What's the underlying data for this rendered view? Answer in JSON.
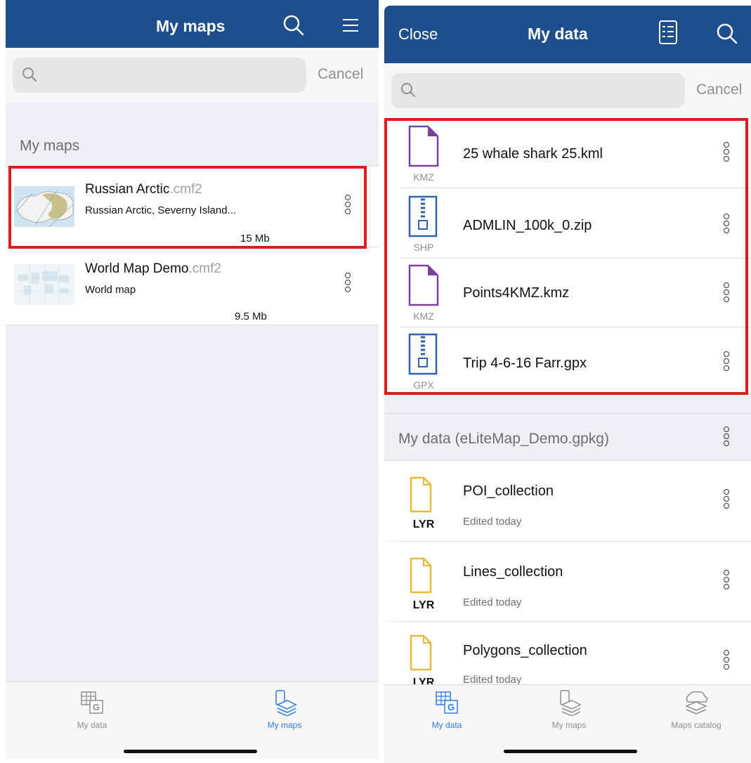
{
  "left": {
    "nav_title": "My maps",
    "search": {
      "placeholder": "",
      "cancel": "Cancel"
    },
    "section": "My maps",
    "maps": [
      {
        "name": "Russian Arctic",
        "ext": ".cmf2",
        "desc": "Russian Arctic, Severny Island...",
        "size": "15 Mb",
        "highlighted": true
      },
      {
        "name": "World Map Demo",
        "ext": ".cmf2",
        "desc": "World map",
        "size": "9.5 Mb",
        "highlighted": false
      }
    ],
    "tabs": [
      {
        "label": "My data",
        "icon": "table-g-icon",
        "active": false
      },
      {
        "label": "My maps",
        "icon": "layers-icon",
        "active": true
      }
    ]
  },
  "right": {
    "nav_close": "Close",
    "nav_title": "My data",
    "search": {
      "placeholder": "",
      "cancel": "Cancel"
    },
    "files": [
      {
        "name": "25 whale shark 25.kml",
        "type": "KMZ",
        "icon": "document-icon",
        "color": "#7b3fa0"
      },
      {
        "name": "ADMLIN_100k_0.zip",
        "type": "SHP",
        "icon": "zip-icon",
        "color": "#2d62b0"
      },
      {
        "name": "Points4KMZ.kmz",
        "type": "KMZ",
        "icon": "document-icon",
        "color": "#7b3fa0"
      },
      {
        "name": "Trip 4-6-16 Farr.gpx",
        "type": "GPX",
        "icon": "zip-icon",
        "color": "#2d62b0"
      }
    ],
    "section": "My data (eLiteMap_Demo.gpkg)",
    "layers": [
      {
        "name": "POI_collection",
        "sub": "Edited today",
        "type": "LYR"
      },
      {
        "name": "Lines_collection",
        "sub": "Edited today",
        "type": "LYR"
      },
      {
        "name": "Polygons_collection",
        "sub": "Edited today",
        "type": "LYR"
      }
    ],
    "tabs": [
      {
        "label": "My data",
        "icon": "table-g-icon",
        "active": true
      },
      {
        "label": "My maps",
        "icon": "layers-icon",
        "active": false
      },
      {
        "label": "Maps catalog",
        "icon": "cloud-layers-icon",
        "active": false
      }
    ]
  },
  "colors": {
    "navbar": "#1f4e8c",
    "highlight": "#e01b1b",
    "active_tab": "#2d7be5",
    "lyr_icon": "#e8b93a"
  }
}
